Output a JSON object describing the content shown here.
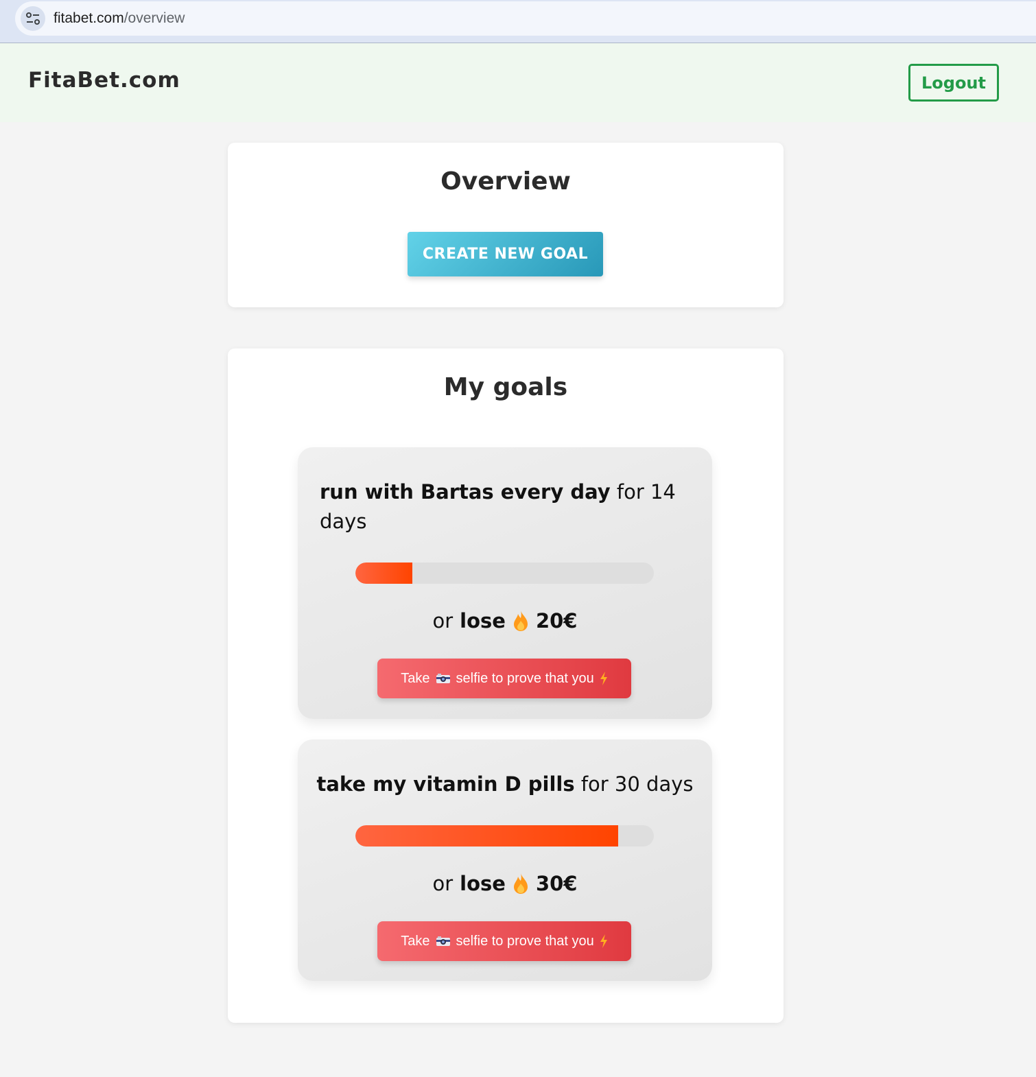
{
  "browser": {
    "url_host": "fitabet.com",
    "url_path": "/overview"
  },
  "header": {
    "brand": "FitaBet.com",
    "logout_label": "Logout"
  },
  "overview": {
    "title": "Overview",
    "create_label": "CREATE NEW GOAL"
  },
  "goals_section": {
    "title": "My goals",
    "goals": [
      {
        "task": "run with Bartas every day",
        "duration": "for 14 days",
        "progress": 0.19,
        "stake_prefix": "or",
        "stake_word": "lose",
        "amount": "20€",
        "cta_take": "Take",
        "cta_rest": "selfie to prove that you"
      },
      {
        "task": "take my vitamin D pills",
        "duration": "for 30 days",
        "progress": 0.88,
        "stake_prefix": "or",
        "stake_word": "lose",
        "amount": "30€",
        "cta_take": "Take",
        "cta_rest": "selfie to prove that you"
      }
    ]
  },
  "icons": {
    "site_info": "tune-icon",
    "stake": "fire-icon",
    "camera": "camera-icon",
    "bolt": "lightning-icon"
  },
  "colors": {
    "brand_green": "#239b48",
    "create_gradient_start": "#62d2e8",
    "create_gradient_end": "#2898b8",
    "progress_fill": "#ff4400",
    "selfie_button": "#e03a40"
  }
}
